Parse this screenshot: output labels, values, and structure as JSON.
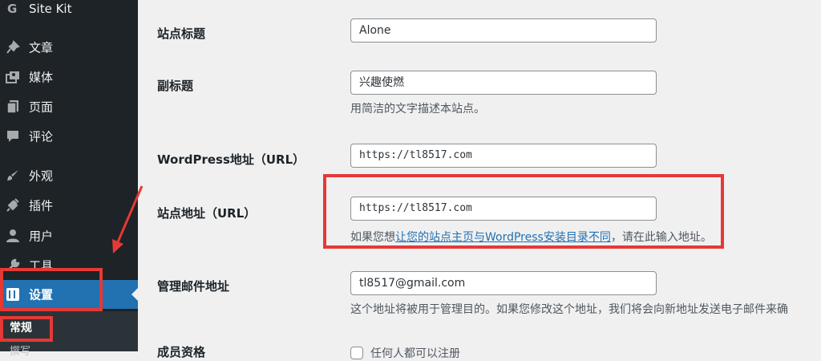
{
  "sidebar": {
    "items": [
      {
        "label": "Site Kit",
        "icon": "google-g-icon"
      },
      {
        "label": "文章",
        "icon": "pin-icon"
      },
      {
        "label": "媒体",
        "icon": "media-icon"
      },
      {
        "label": "页面",
        "icon": "pages-icon"
      },
      {
        "label": "评论",
        "icon": "comment-icon"
      },
      {
        "label": "外观",
        "icon": "brush-icon"
      },
      {
        "label": "插件",
        "icon": "plugin-icon"
      },
      {
        "label": "用户",
        "icon": "user-icon"
      },
      {
        "label": "工具",
        "icon": "wrench-icon"
      },
      {
        "label": "设置",
        "icon": "settings-icon",
        "active": true
      }
    ],
    "submenu": {
      "current": "常规",
      "next": "撰写"
    }
  },
  "form": {
    "site_title": {
      "label": "站点标题",
      "value": "Alone"
    },
    "tagline": {
      "label": "副标题",
      "value": "兴趣使燃",
      "description": "用简洁的文字描述本站点。"
    },
    "wp_address": {
      "label": "WordPress地址（URL）",
      "value": "https://tl8517.com"
    },
    "site_address": {
      "label": "站点地址（URL）",
      "value": "https://tl8517.com",
      "desc_prefix": "如果您想",
      "desc_link": "让您的站点主页与WordPress安装目录不同",
      "desc_suffix": "，请在此输入地址。"
    },
    "admin_email": {
      "label": "管理邮件地址",
      "value": "tl8517@gmail.com",
      "description": "这个地址将被用于管理目的。如果您修改这个地址，我们将会向新地址发送电子邮件来确"
    },
    "membership": {
      "label": "成员资格",
      "checkbox_label": "任何人都可以注册"
    }
  },
  "colors": {
    "sidebar_bg": "#1d2327",
    "active_bg": "#2271b1",
    "link": "#2271b1",
    "annotation_red": "#e53935"
  }
}
